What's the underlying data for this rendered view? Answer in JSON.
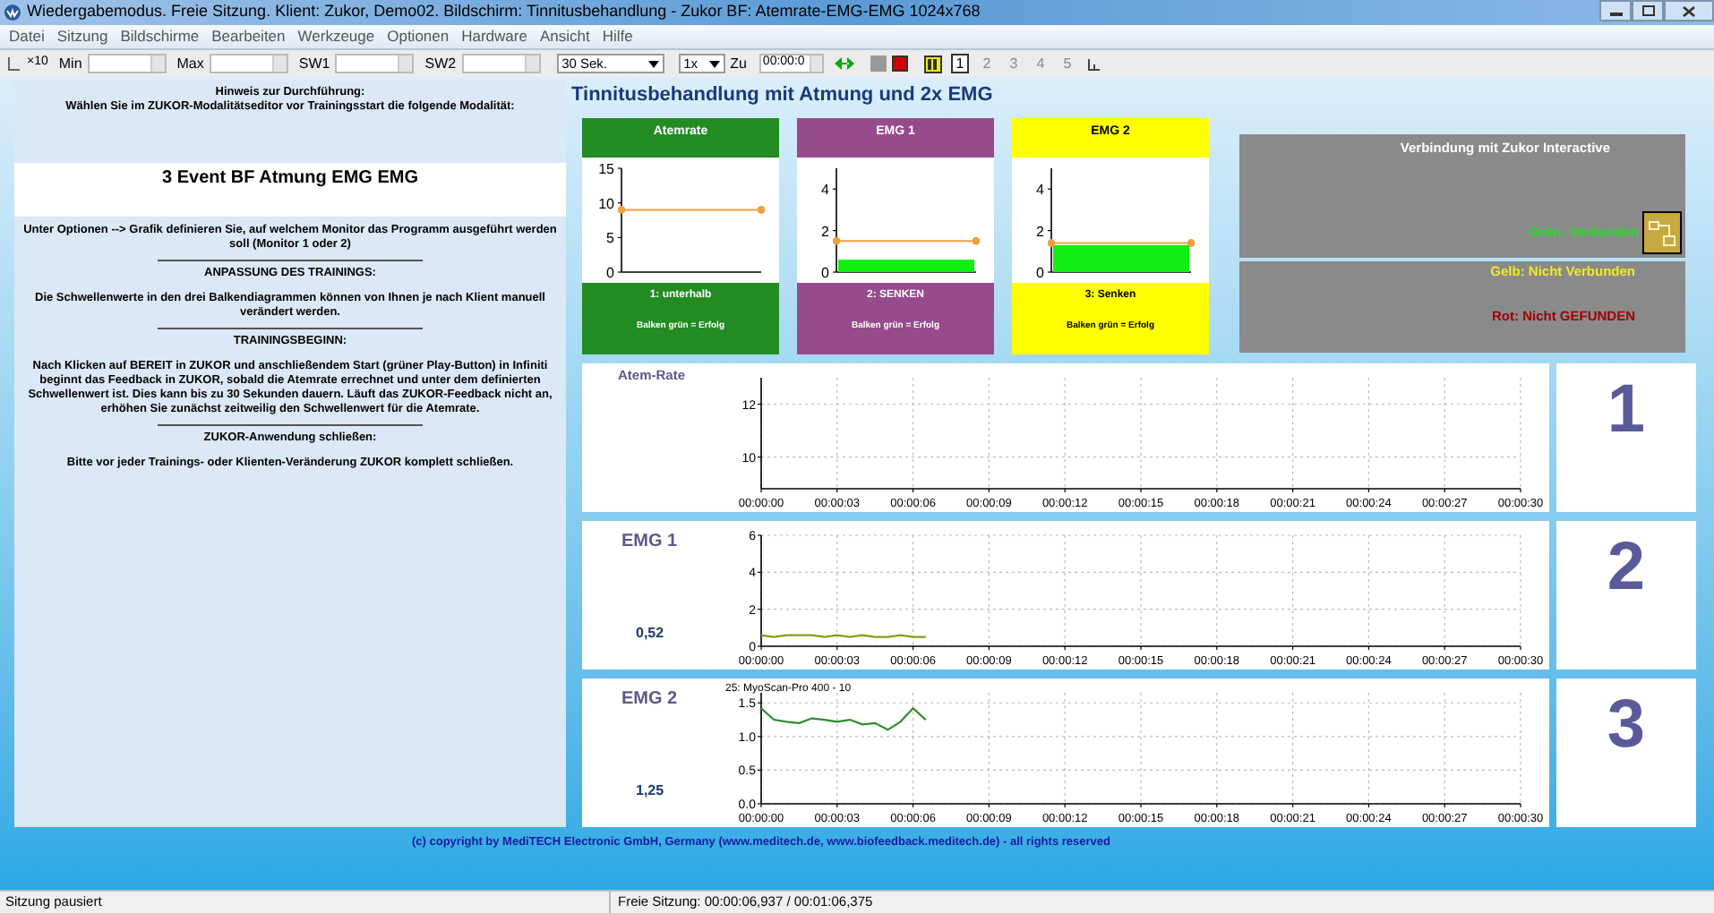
{
  "window": {
    "title": "Wiedergabemodus. Freie Sitzung. Klient: Zukor, Demo02. Bildschirm: Tinnitusbehandlung - Zukor BF: Atemrate-EMG-EMG 1024x768"
  },
  "menu": [
    "Datei",
    "Sitzung",
    "Bildschirme",
    "Bearbeiten",
    "Werkzeuge",
    "Optionen",
    "Hardware",
    "Ansicht",
    "Hilfe"
  ],
  "toolbar": {
    "scale_label": "×10",
    "fields": [
      {
        "label": "Min"
      },
      {
        "label": "Max"
      },
      {
        "label": "SW1"
      },
      {
        "label": "SW2"
      }
    ],
    "duration": "30 Sek.",
    "speed": "1x",
    "to_label": "Zu",
    "time": "00:00:0",
    "pages": [
      {
        "label": "1",
        "selected": true
      },
      {
        "label": "2",
        "selected": false
      },
      {
        "label": "3",
        "selected": false
      },
      {
        "label": "4",
        "selected": false
      },
      {
        "label": "5",
        "selected": false
      }
    ]
  },
  "instructions": {
    "hint_title": "Hinweis zur Durchführung:",
    "hint_text": "Wählen Sie im ZUKOR-Modalitätseditor vor Trainingsstart die folgende Modalität:",
    "modality": "3 Event BF Atmung EMG EMG",
    "paragraphs": [
      {
        "kind": "text",
        "text": "Unter Optionen --> Grafik definieren Sie, auf welchem Monitor das Programm ausgeführt werden soll (Monitor 1 oder 2)"
      },
      {
        "kind": "heading",
        "text": "ANPASSUNG DES TRAININGS:"
      },
      {
        "kind": "text",
        "text": "Die Schwellenwerte in den drei Balkendiagrammen können von Ihnen je nach Klient manuell verändert werden."
      },
      {
        "kind": "heading",
        "text": "TRAININGSBEGINN:"
      },
      {
        "kind": "text",
        "text": "Nach Klicken auf BEREIT in ZUKOR und anschließendem Start (grüner Play-Button) in Infiniti beginnt das Feedback in ZUKOR, sobald die Atemrate errechnet und unter dem definierten Schwellenwert ist. Dies kann bis zu 30 Sekunden dauern. Läuft das ZUKOR-Feedback nicht an, erhöhen Sie zunächst zeitweilig den Schwellenwert für die Atemrate."
      },
      {
        "kind": "heading",
        "text": "ZUKOR-Anwendung schließen:"
      },
      {
        "kind": "text",
        "text": "Bitte vor jeder Trainings- oder Klienten-Veränderung ZUKOR komplett schließen."
      }
    ]
  },
  "screen_title": "Tinnitusbehandlung mit Atmung und 2x EMG",
  "bar_cards": [
    {
      "title": "Atemrate",
      "color": "#228b22",
      "mode": "1: unterhalb",
      "note": "Balken grün = Erfolg",
      "chart_data": {
        "type": "bar",
        "values": [
          0
        ],
        "ylim": [
          0,
          15
        ],
        "yticks": [
          0,
          5,
          10,
          15
        ],
        "ref_lines": [
          {
            "axis": "y",
            "value": 9,
            "color": "#f0a040"
          }
        ]
      }
    },
    {
      "title": "EMG 1",
      "color": "#964b8c",
      "mode": "2: SENKEN",
      "note": "Balken grün = Erfolg",
      "chart_data": {
        "type": "bar",
        "values": [
          0.6
        ],
        "ylim": [
          0,
          5
        ],
        "yticks": [
          0,
          2,
          4
        ],
        "ref_lines": [
          {
            "axis": "y",
            "value": 1.5,
            "color": "#f0a040"
          }
        ]
      }
    },
    {
      "title": "EMG 2",
      "color": "#ffff00",
      "mode": "3: Senken",
      "note": "Balken grün = Erfolg",
      "chart_data": {
        "type": "bar",
        "values": [
          1.3
        ],
        "ylim": [
          0,
          5
        ],
        "yticks": [
          0,
          2,
          4
        ],
        "ref_lines": [
          {
            "axis": "y",
            "value": 1.4,
            "color": "#f0a040"
          }
        ]
      }
    }
  ],
  "connection": {
    "title": "Verbindung mit Zukor Interactive",
    "legend": [
      {
        "text": "Grün: Verbunden",
        "color": "#22dd22"
      },
      {
        "text": "Gelb: Nicht Verbunden",
        "color": "#eeee22"
      },
      {
        "text": "Rot: Nicht GEFUNDEN",
        "color": "#a00000"
      }
    ]
  },
  "channels": [
    {
      "label": "Atem-Rate",
      "number": "1",
      "chart_data": {
        "type": "line",
        "grid": true,
        "xlim": [
          0,
          30
        ],
        "ylim": [
          8.8,
          13
        ],
        "yticks": [
          10,
          12
        ],
        "xticks": [
          {
            "value": 0,
            "label": "00:00:00"
          },
          {
            "value": 3,
            "label": "00:00:03"
          },
          {
            "value": 6,
            "label": "00:00:06"
          },
          {
            "value": 9,
            "label": "00:00:09"
          },
          {
            "value": 12,
            "label": "00:00:12"
          },
          {
            "value": 15,
            "label": "00:00:15"
          },
          {
            "value": 18,
            "label": "00:00:18"
          },
          {
            "value": 21,
            "label": "00:00:21"
          },
          {
            "value": 24,
            "label": "00:00:24"
          },
          {
            "value": 27,
            "label": "00:00:27"
          },
          {
            "value": 30,
            "label": "00:00:30"
          }
        ]
      }
    },
    {
      "label": "EMG 1",
      "value": "0,52",
      "number": "2",
      "chart_data": {
        "type": "line",
        "grid": true,
        "xlim": [
          0,
          30
        ],
        "ylim": [
          0,
          6
        ],
        "yticks": [
          0,
          2,
          4,
          6
        ],
        "xticks": [
          {
            "value": 0,
            "label": "00:00:00"
          },
          {
            "value": 3,
            "label": "00:00:03"
          },
          {
            "value": 6,
            "label": "00:00:06"
          },
          {
            "value": 9,
            "label": "00:00:09"
          },
          {
            "value": 12,
            "label": "00:00:12"
          },
          {
            "value": 15,
            "label": "00:00:15"
          },
          {
            "value": 18,
            "label": "00:00:18"
          },
          {
            "value": 21,
            "label": "00:00:21"
          },
          {
            "value": 24,
            "label": "00:00:24"
          },
          {
            "value": 27,
            "label": "00:00:27"
          },
          {
            "value": 30,
            "label": "00:00:30"
          }
        ],
        "x": [
          0,
          0.5,
          1,
          1.5,
          2,
          2.5,
          3,
          3.5,
          4,
          4.5,
          5,
          5.5,
          6,
          6.5
        ],
        "series": [
          {
            "color": "#8a9a1a",
            "values": [
              0.6,
              0.5,
              0.6,
              0.6,
              0.6,
              0.5,
              0.6,
              0.5,
              0.6,
              0.5,
              0.5,
              0.6,
              0.5,
              0.5
            ]
          }
        ]
      }
    },
    {
      "label": "EMG 2",
      "value": "1,25",
      "number": "3",
      "caption": "25: MyoScan-Pro 400 - 10",
      "chart_data": {
        "type": "line",
        "grid": true,
        "xlim": [
          0,
          30
        ],
        "ylim": [
          0,
          1.65
        ],
        "yticks": [
          {
            "value": 0,
            "label": "0.0"
          },
          {
            "value": 0.5,
            "label": "0.5"
          },
          {
            "value": 1,
            "label": "1.0"
          },
          {
            "value": 1.5,
            "label": "1.5"
          }
        ],
        "xticks": [
          {
            "value": 0,
            "label": "00:00:00"
          },
          {
            "value": 3,
            "label": "00:00:03"
          },
          {
            "value": 6,
            "label": "00:00:06"
          },
          {
            "value": 9,
            "label": "00:00:09"
          },
          {
            "value": 12,
            "label": "00:00:12"
          },
          {
            "value": 15,
            "label": "00:00:15"
          },
          {
            "value": 18,
            "label": "00:00:18"
          },
          {
            "value": 21,
            "label": "00:00:21"
          },
          {
            "value": 24,
            "label": "00:00:24"
          },
          {
            "value": 27,
            "label": "00:00:27"
          },
          {
            "value": 30,
            "label": "00:00:30"
          }
        ],
        "x": [
          0,
          0.5,
          1,
          1.5,
          2,
          2.5,
          3,
          3.5,
          4,
          4.5,
          5,
          5.5,
          6,
          6.5
        ],
        "series": [
          {
            "color": "#2e8b2e",
            "values": [
              1.42,
              1.25,
              1.22,
              1.2,
              1.27,
              1.25,
              1.22,
              1.25,
              1.18,
              1.2,
              1.1,
              1.22,
              1.42,
              1.25
            ]
          }
        ]
      }
    }
  ],
  "copyright": "(c) copyright by MediTECH Electronic GmbH, Germany (www.meditech.de, www.biofeedback.meditech.de) - all rights reserved",
  "status_bar": {
    "state": "Sitzung pausiert",
    "session": "Freie Sitzung: 00:00:06,937 / 00:01:06,375"
  }
}
